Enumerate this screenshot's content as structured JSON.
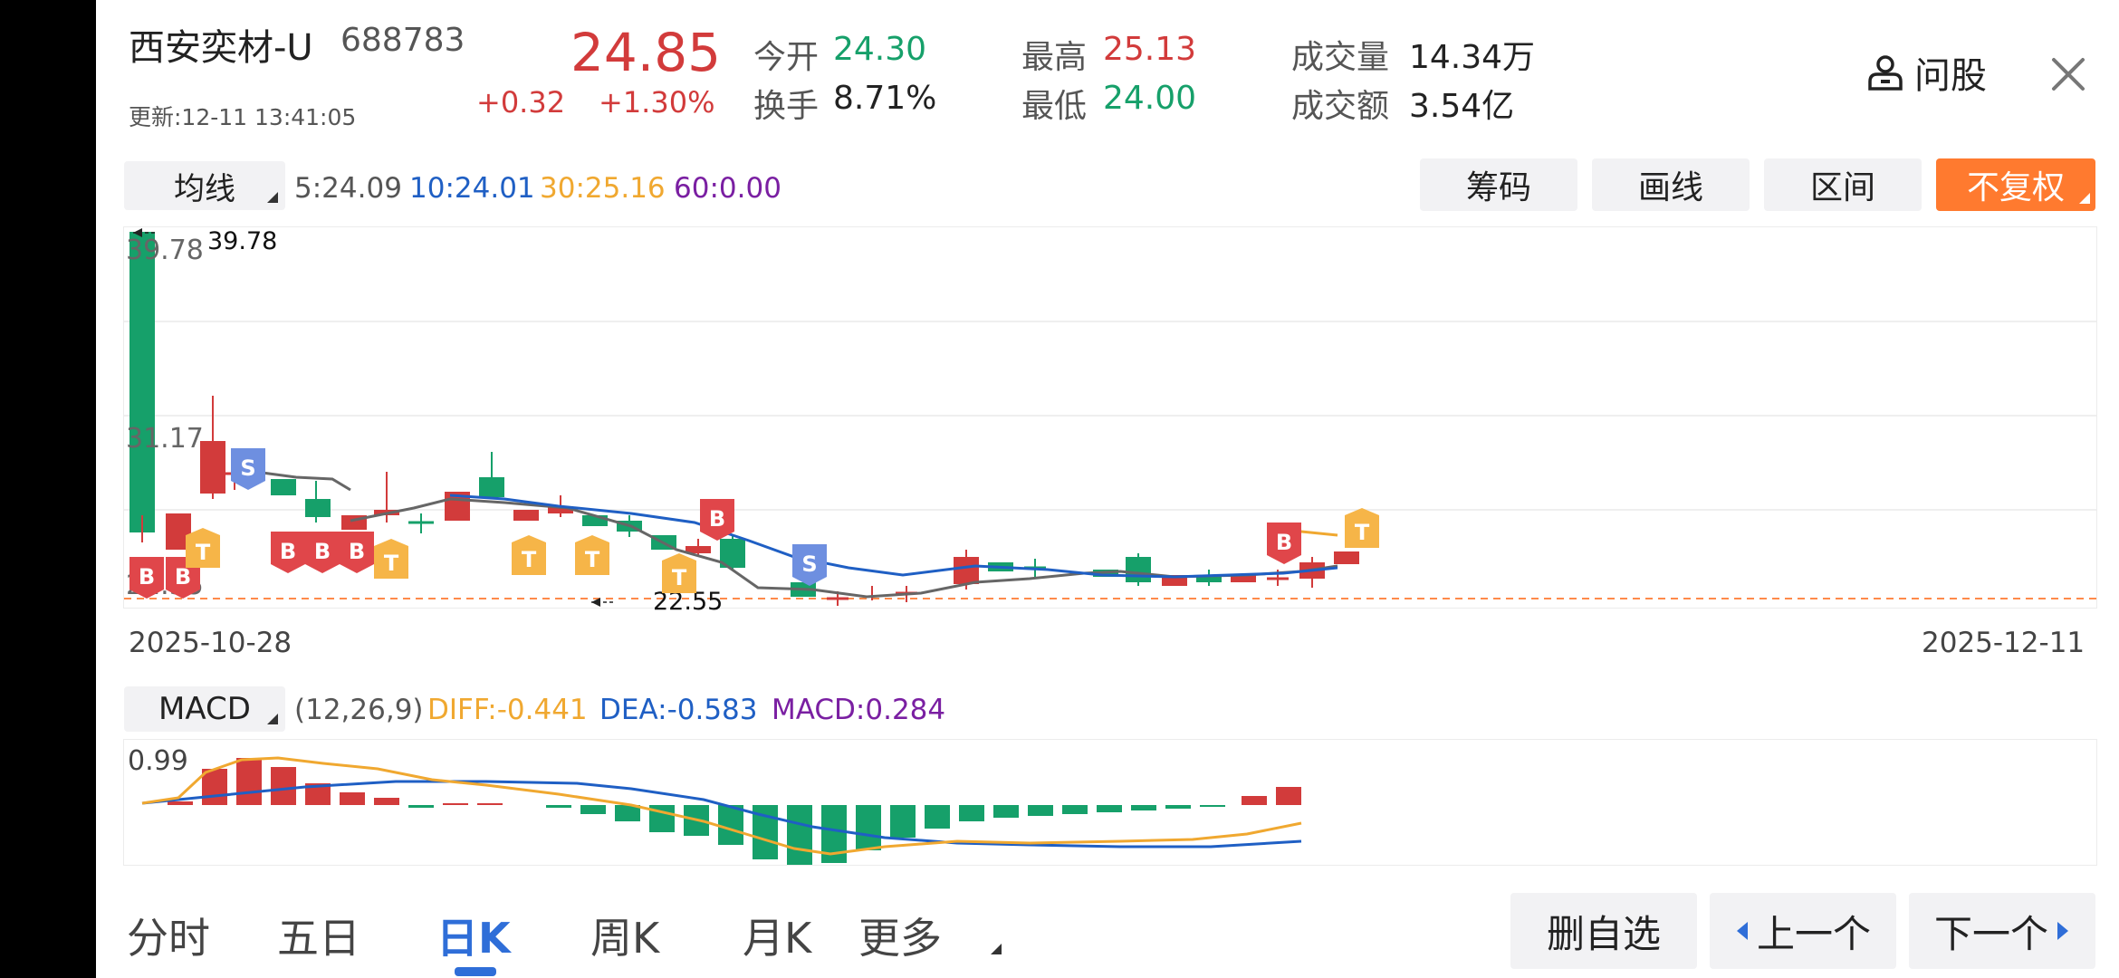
{
  "quote": {
    "name": "西安奕材-U",
    "code": "688783",
    "updated": "更新:12-11 13:41:05",
    "price": "24.85",
    "change": "+0.32",
    "change_pct": "+1.30%",
    "open_label": "今开",
    "open": "24.30",
    "turnover_label": "换手",
    "turnover": "8.71%",
    "high_label": "最高",
    "high": "25.13",
    "low_label": "最低",
    "low": "24.00",
    "volume_label": "成交量",
    "volume": "14.34万",
    "amount_label": "成交额",
    "amount": "3.54亿",
    "ask_label": "问股",
    "colors": {
      "up": "#d23b3b",
      "down": "#16a06a",
      "accent": "#ff7a2f"
    }
  },
  "ma_bar": {
    "selector": "均线",
    "ma5": "5:24.09",
    "ma10": "10:24.01",
    "ma30": "30:25.16",
    "ma60": "60:0.00",
    "colors": {
      "ma5": "#555555",
      "ma10": "#1f5fc4",
      "ma30": "#f0a830",
      "ma60": "#7a1fa2"
    }
  },
  "tools": [
    "筹码",
    "画线",
    "区间",
    "不复权"
  ],
  "kline": {
    "max_label": "39.78",
    "max_axis": "39.78",
    "mid_axis": "31.17",
    "low_axis": "22.55",
    "min_label": "22.55",
    "date_start": "2025-10-28",
    "date_end": "2025-12-11",
    "markers": [
      "B",
      "B",
      "T",
      "S",
      "B",
      "B",
      "B",
      "T",
      "T",
      "T",
      "T",
      "B",
      "S",
      "B",
      "T"
    ]
  },
  "macd": {
    "selector": "MACD",
    "params": "(12,26,9)",
    "diff": "DIFF:-0.441",
    "dea": "DEA:-0.583",
    "macd": "MACD:0.284",
    "axis_top": "0.99",
    "colors": {
      "diff": "#f0a830",
      "dea": "#1f5fc4",
      "macd": "#7a1fa2"
    }
  },
  "bottom": {
    "tabs": [
      "分时",
      "五日",
      "日K",
      "周K",
      "月K",
      "更多"
    ],
    "active": "日K",
    "delete_btn": "删自选",
    "prev_btn": "上一个",
    "next_btn": "下一个"
  }
}
